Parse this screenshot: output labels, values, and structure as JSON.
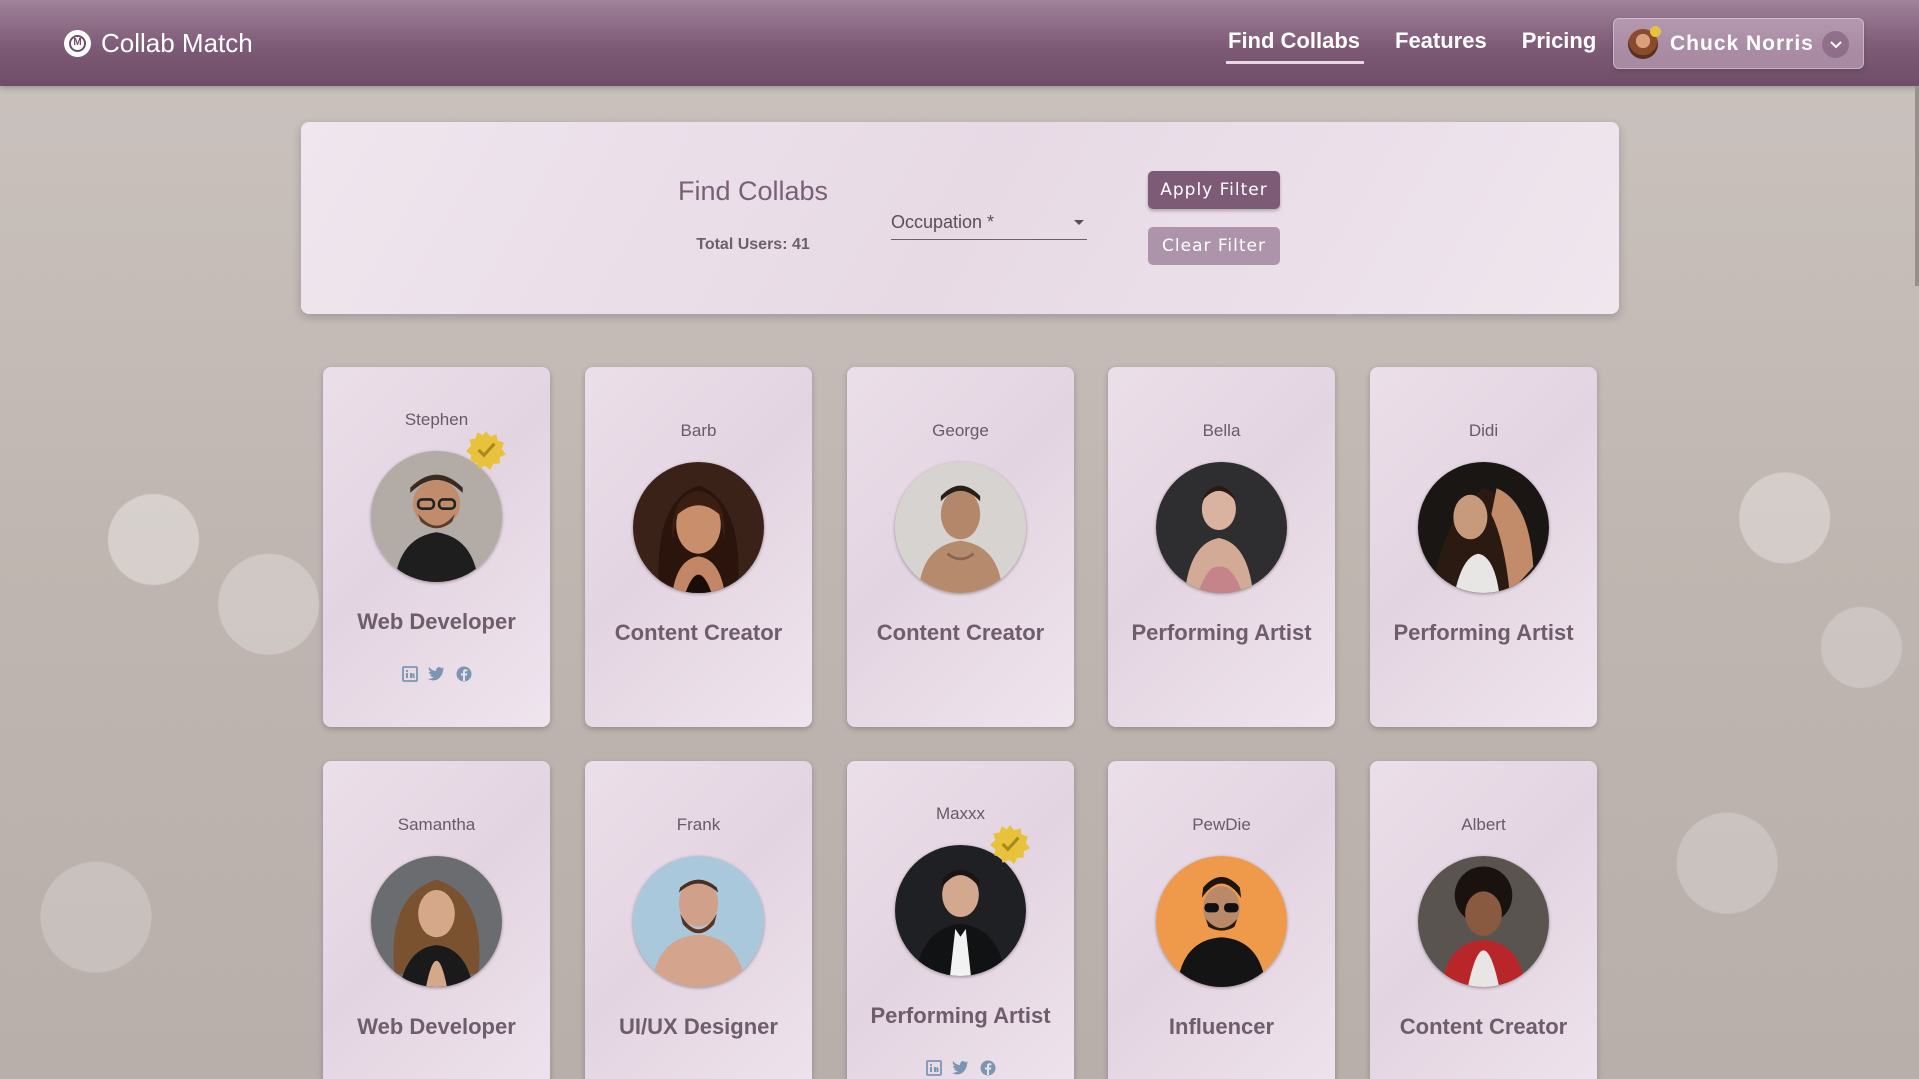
{
  "nav": {
    "brand": "Collab Match",
    "links": [
      "Find Collabs",
      "Features",
      "Pricing"
    ],
    "user_name": "Chuck Norris"
  },
  "filter": {
    "title": "Find Collabs",
    "total_users": "Total Users: 41",
    "occupation_label": "Occupation *",
    "apply_label": "Apply Filter",
    "clear_label": "Clear Filter"
  },
  "users": [
    {
      "name": "Stephen",
      "role": "Web Developer",
      "verified": true
    },
    {
      "name": "Barb",
      "role": "Content Creator",
      "verified": false
    },
    {
      "name": "George",
      "role": "Content Creator",
      "verified": false
    },
    {
      "name": "Bella",
      "role": "Performing Artist",
      "verified": false
    },
    {
      "name": "Didi",
      "role": "Performing Artist",
      "verified": false
    },
    {
      "name": "Samantha",
      "role": "Web Developer",
      "verified": false
    },
    {
      "name": "Frank",
      "role": "UI/UX Designer",
      "verified": false
    },
    {
      "name": "Maxxx",
      "role": "Performing Artist",
      "verified": true
    },
    {
      "name": "PewDie",
      "role": "Influencer",
      "verified": false
    },
    {
      "name": "Albert",
      "role": "Content Creator",
      "verified": false
    }
  ],
  "colors": {
    "nav": "#7d5a76",
    "social_icons": "#7b95b3",
    "badge": "#e8c23a"
  }
}
